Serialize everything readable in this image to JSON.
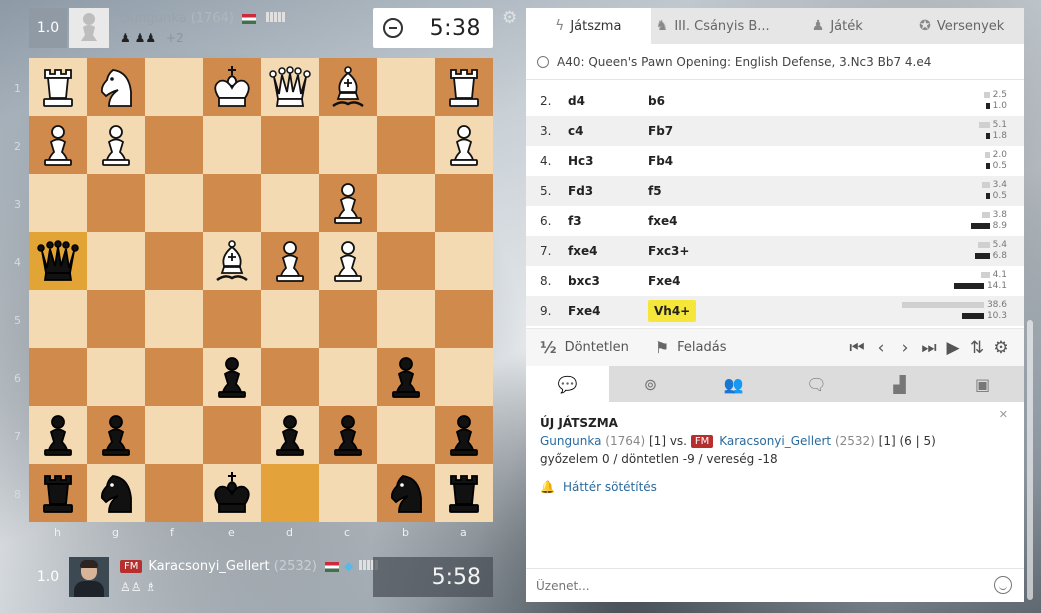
{
  "top_player": {
    "score": "1.0",
    "name": "Gungunka",
    "rating": "(1764)",
    "captured": "♟ ♟♟",
    "captured_extra": "+2",
    "clock": "5:38"
  },
  "bottom_player": {
    "score": "1.0",
    "title": "FM",
    "name": "Karacsonyi_Gellert",
    "rating": "(2532)",
    "captured": "♙♙ ♗",
    "clock": "5:58"
  },
  "board": {
    "ranks": [
      "1",
      "2",
      "3",
      "4",
      "5",
      "6",
      "7",
      "8"
    ],
    "files": [
      "h",
      "g",
      "f",
      "e",
      "d",
      "c",
      "b",
      "a"
    ],
    "rows": [
      [
        "wR",
        "wN",
        "",
        "wK",
        "wQ",
        "wB",
        "",
        "wR"
      ],
      [
        "wP",
        "wP",
        "",
        "",
        "",
        "",
        "",
        "wP"
      ],
      [
        "",
        "",
        "",
        "",
        "",
        "wP",
        "",
        ""
      ],
      [
        "bQ",
        "",
        "",
        "wB",
        "wP",
        "wP",
        "",
        ""
      ],
      [
        "",
        "",
        "",
        "",
        "",
        "",
        "",
        ""
      ],
      [
        "",
        "",
        "",
        "bP",
        "",
        "",
        "bP",
        ""
      ],
      [
        "bP",
        "bP",
        "",
        "",
        "bP",
        "bP",
        "",
        "bP"
      ],
      [
        "bR",
        "bN",
        "",
        "bK",
        "",
        "",
        "bN",
        "bR"
      ]
    ],
    "highlight_from": [
      7,
      4
    ],
    "highlight_to": [
      3,
      0
    ]
  },
  "tabs": [
    {
      "label": "Játszma",
      "icon": "bolt-icon"
    },
    {
      "label": "III. Csányis B...",
      "icon": "paw-icon"
    },
    {
      "label": "Játék",
      "icon": "pawn-icon"
    },
    {
      "label": "Versenyek",
      "icon": "medal-icon"
    }
  ],
  "opening": "A40: Queen's Pawn Opening: English Defense, 3.Nc3 Bb7 4.e4",
  "moves": [
    {
      "num": "2.",
      "w": "d4",
      "b": "b6",
      "ew": "2.5",
      "eb": "1.0",
      "fw": 2.5,
      "fb": 1.0
    },
    {
      "num": "3.",
      "w": "c4",
      "b": "Fb7",
      "ew": "5.1",
      "eb": "1.8",
      "fw": 5.1,
      "fb": 1.8
    },
    {
      "num": "4.",
      "w": "Hc3",
      "b": "Fb4",
      "ew": "2.0",
      "eb": "0.5",
      "fw": 2.0,
      "fb": 0.5
    },
    {
      "num": "5.",
      "w": "Fd3",
      "b": "f5",
      "ew": "3.4",
      "eb": "0.5",
      "fw": 3.4,
      "fb": 0.5
    },
    {
      "num": "6.",
      "w": "f3",
      "b": "fxe4",
      "ew": "3.8",
      "eb": "8.9",
      "fw": 3.8,
      "fb": 8.9
    },
    {
      "num": "7.",
      "w": "fxe4",
      "b": "Fxc3+",
      "ew": "5.4",
      "eb": "6.8",
      "fw": 5.4,
      "fb": 6.8
    },
    {
      "num": "8.",
      "w": "bxc3",
      "b": "Fxe4",
      "ew": "4.1",
      "eb": "14.1",
      "fw": 4.1,
      "fb": 14.1
    },
    {
      "num": "9.",
      "w": "Fxe4",
      "b": "Vh4+",
      "ew": "38.6",
      "eb": "10.3",
      "fw": 38.6,
      "fb": 10.3
    }
  ],
  "current_move_index": 7,
  "actions": {
    "draw_symbol": "½",
    "draw": "Döntetlen",
    "resign": "Feladás"
  },
  "nav_icons": [
    "first-icon",
    "prev-icon",
    "next-icon",
    "last-icon",
    "play-icon",
    "flip-icon",
    "gear-icon"
  ],
  "chat_tabs": [
    "chat-bubble-icon",
    "binoculars-icon",
    "users-icon",
    "comments-icon",
    "podium-icon",
    "camera-icon"
  ],
  "chat": {
    "heading": "ÚJ JÁTSZMA",
    "p1": "Gungunka",
    "p1_rating": "(1764)",
    "p1_extra": "[1] vs.",
    "title": "FM",
    "p2": "Karacsonyi_Gellert",
    "p2_rating": "(2532)",
    "p2_extra": "[1] (6 | 5)",
    "result": "győzelem 0 / döntetlen -9 / vereség -18",
    "dim_toggle": "Háttér sötétítés",
    "placeholder": "Üzenet..."
  },
  "colors": {
    "move_highlight": "#f6e63a",
    "fm_badge": "#b52f2f",
    "link": "#2a6a9e"
  }
}
